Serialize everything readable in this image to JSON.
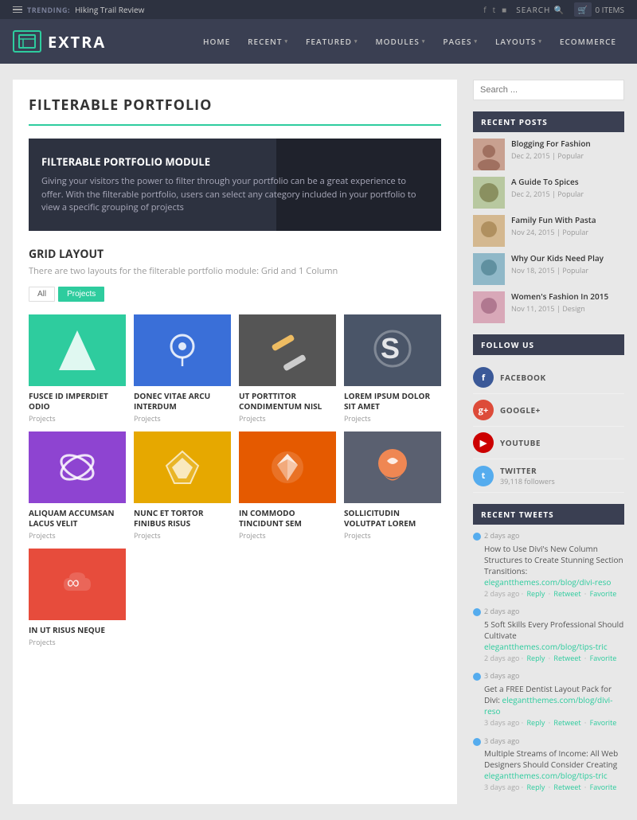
{
  "topbar": {
    "trending_label": "TRENDING:",
    "trending_value": "Hiking Trail Review",
    "search_label": "SEARCH",
    "cart_label": "0 ITEMS"
  },
  "nav": {
    "logo_text": "EXTRA",
    "items": [
      {
        "label": "HOME",
        "has_arrow": false
      },
      {
        "label": "RECENT",
        "has_arrow": true
      },
      {
        "label": "FEATURED",
        "has_arrow": true
      },
      {
        "label": "MODULES",
        "has_arrow": true
      },
      {
        "label": "PAGES",
        "has_arrow": true
      },
      {
        "label": "LAYOUTS",
        "has_arrow": true
      },
      {
        "label": "ECOMMERCE",
        "has_arrow": false
      }
    ]
  },
  "main": {
    "page_title": "FILTERABLE PORTFOLIO",
    "hero": {
      "title": "FILTERABLE PORTFOLIO MODULE",
      "text": "Giving your visitors the power to filter through your portfolio can be a great experience to offer. With the filterable portfolio, users can select any category included in your portfolio to view a specific grouping of projects"
    },
    "grid": {
      "title": "GRID LAYOUT",
      "subtitle": "There are two layouts for the filterable portfolio module: Grid and 1 Column",
      "filter_all": "All",
      "filter_projects": "Projects",
      "items": [
        {
          "title": "FUSCE ID IMPERDIET ODIO",
          "category": "Projects",
          "thumb_class": "thumb-1"
        },
        {
          "title": "DONEC VITAE ARCU INTERDUM",
          "category": "Projects",
          "thumb_class": "thumb-2"
        },
        {
          "title": "UT PORTTITOR CONDIMENTUM NISL",
          "category": "Projects",
          "thumb_class": "thumb-3"
        },
        {
          "title": "LOREM IPSUM DOLOR SIT AMET",
          "category": "Projects",
          "thumb_class": "thumb-4"
        },
        {
          "title": "ALIQUAM ACCUMSAN LACUS VELIT",
          "category": "Projects",
          "thumb_class": "thumb-5"
        },
        {
          "title": "NUNC ET TORTOR FINIBUS RISUS",
          "category": "Projects",
          "thumb_class": "thumb-6"
        },
        {
          "title": "IN COMMODO TINCIDUNT SEM",
          "category": "Projects",
          "thumb_class": "thumb-7"
        },
        {
          "title": "SOLLICITUDIN VOLUTPAT LOREM",
          "category": "Projects",
          "thumb_class": "thumb-8"
        },
        {
          "title": "IN UT RISUS NEQUE",
          "category": "Projects",
          "thumb_class": "thumb-9"
        }
      ]
    }
  },
  "sidebar": {
    "search_placeholder": "Search ...",
    "recent_posts_title": "RECENT POSTS",
    "recent_posts": [
      {
        "title": "Blogging For Fashion",
        "date": "Dec 2, 2015",
        "tag": "Popular"
      },
      {
        "title": "A Guide To Spices",
        "date": "Dec 2, 2015",
        "tag": "Popular"
      },
      {
        "title": "Family Fun With Pasta",
        "date": "Nov 24, 2015",
        "tag": "Popular"
      },
      {
        "title": "Why Our Kids Need Play",
        "date": "Nov 18, 2015",
        "tag": "Popular"
      },
      {
        "title": "Women's Fashion In 2015",
        "date": "Nov 11, 2015",
        "tag": "Design"
      }
    ],
    "follow_us_title": "FOLLOW US",
    "follow_items": [
      {
        "name": "FACEBOOK",
        "platform": "fb"
      },
      {
        "name": "GOOGLE+",
        "platform": "gp"
      },
      {
        "name": "YOUTUBE",
        "platform": "yt"
      },
      {
        "name": "TWITTER",
        "count": "39,118 followers",
        "platform": "tw"
      }
    ],
    "tweets_title": "RECENT TWEETS",
    "tweets": [
      {
        "text": "How to Use Divi's New Column Structures to Create Stunning Section Transitions:",
        "link": "elegantthemes.com/blog/divi-reso",
        "time": "2 days ago",
        "actions": [
          "Reply",
          "Retweet",
          "Favorite"
        ]
      },
      {
        "text": "5 Soft Skills Every Professional Should Cultivate",
        "link": "elegantthemes.com/blog/tips-tric",
        "time": "2 days ago",
        "actions": [
          "Reply",
          "Retweet",
          "Favorite"
        ]
      },
      {
        "text": "Get a FREE Dentist Layout Pack for Divi:",
        "link": "elegantthemes.com/blog/divi-reso",
        "time": "3 days ago",
        "actions": [
          "Reply",
          "Retweet",
          "Favorite"
        ]
      },
      {
        "text": "Multiple Streams of Income: All Web Designers Should Consider Creating",
        "link": "elegantthemes.com/blog/tips-tric",
        "time": "3 days ago",
        "actions": [
          "Reply",
          "Retweet",
          "Favorite"
        ]
      }
    ]
  }
}
